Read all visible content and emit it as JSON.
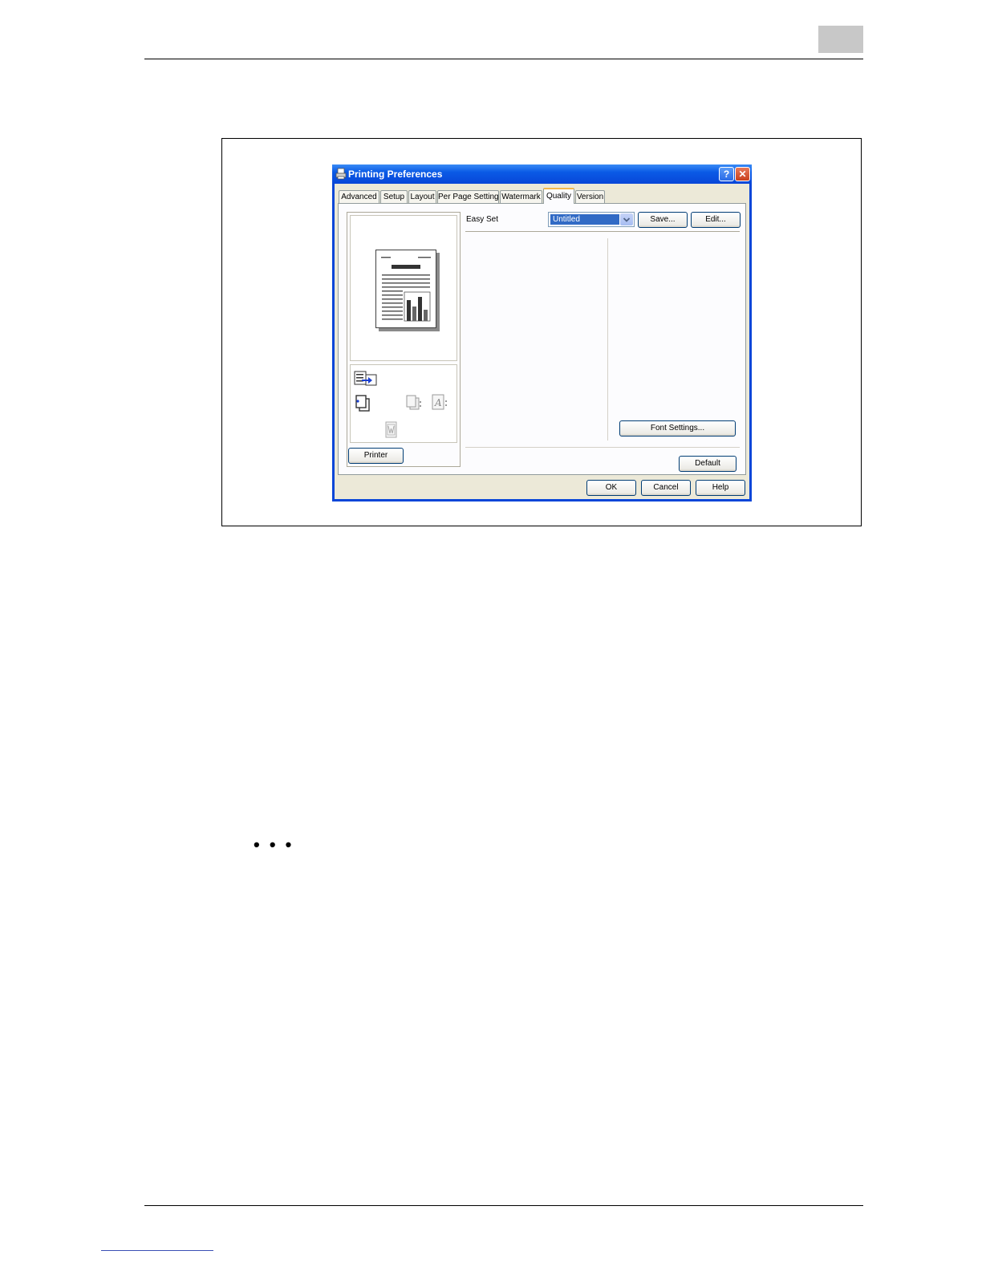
{
  "dialog": {
    "title": "Printing Preferences",
    "help_glyph": "?",
    "close_glyph": "✕",
    "tabs": [
      {
        "label": "Advanced"
      },
      {
        "label": "Setup"
      },
      {
        "label": "Layout"
      },
      {
        "label": "Per Page Setting"
      },
      {
        "label": "Watermark"
      },
      {
        "label": "Quality",
        "active": true
      },
      {
        "label": "Version"
      }
    ],
    "easy_set": {
      "label": "Easy Set",
      "value": "Untitled",
      "save_label": "Save...",
      "edit_label": "Edit..."
    },
    "font_settings_label": "Font Settings...",
    "default_label": "Default",
    "printer_label": "Printer",
    "footer": {
      "ok_label": "OK",
      "cancel_label": "Cancel",
      "help_label": "Help"
    }
  },
  "page": {
    "bullet_marks": "• • •"
  },
  "colors": {
    "titlebar": "#0846d8",
    "selection": "#316ac5",
    "face": "#ece9d8",
    "active_tab_accent": "#f3b84a"
  }
}
